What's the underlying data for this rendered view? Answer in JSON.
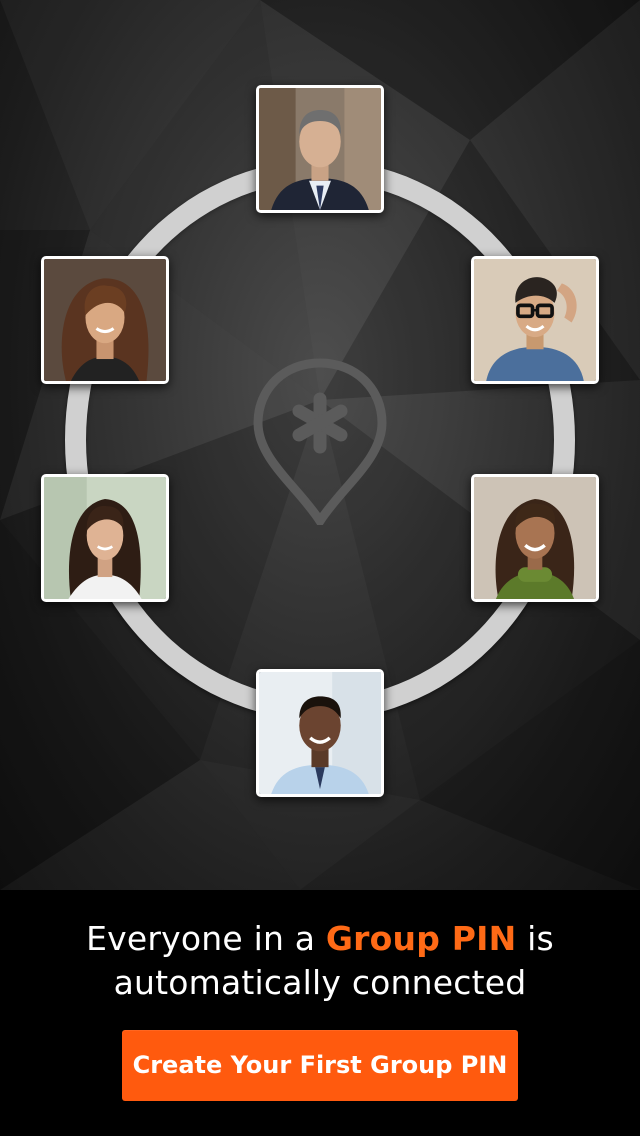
{
  "screen": {
    "headline_line1_pre": "Everyone in a ",
    "headline_highlight": "Group PIN",
    "headline_line1_post": " is",
    "headline_line2": "automatically connected",
    "cta_label": "Create Your First Group PIN"
  },
  "avatars": [
    {
      "position": "top",
      "icon": "person-photo"
    },
    {
      "position": "upper-left",
      "icon": "person-photo"
    },
    {
      "position": "upper-right",
      "icon": "person-photo"
    },
    {
      "position": "lower-left",
      "icon": "person-photo"
    },
    {
      "position": "lower-right",
      "icon": "person-photo"
    },
    {
      "position": "bottom",
      "icon": "person-photo"
    }
  ],
  "icons": {
    "center_logo": "location-pin-asterisk-icon"
  },
  "colors": {
    "accent": "#ff6a16",
    "button": "#ff5a0e",
    "ring": "#d0d0d0",
    "background": "#000000"
  }
}
